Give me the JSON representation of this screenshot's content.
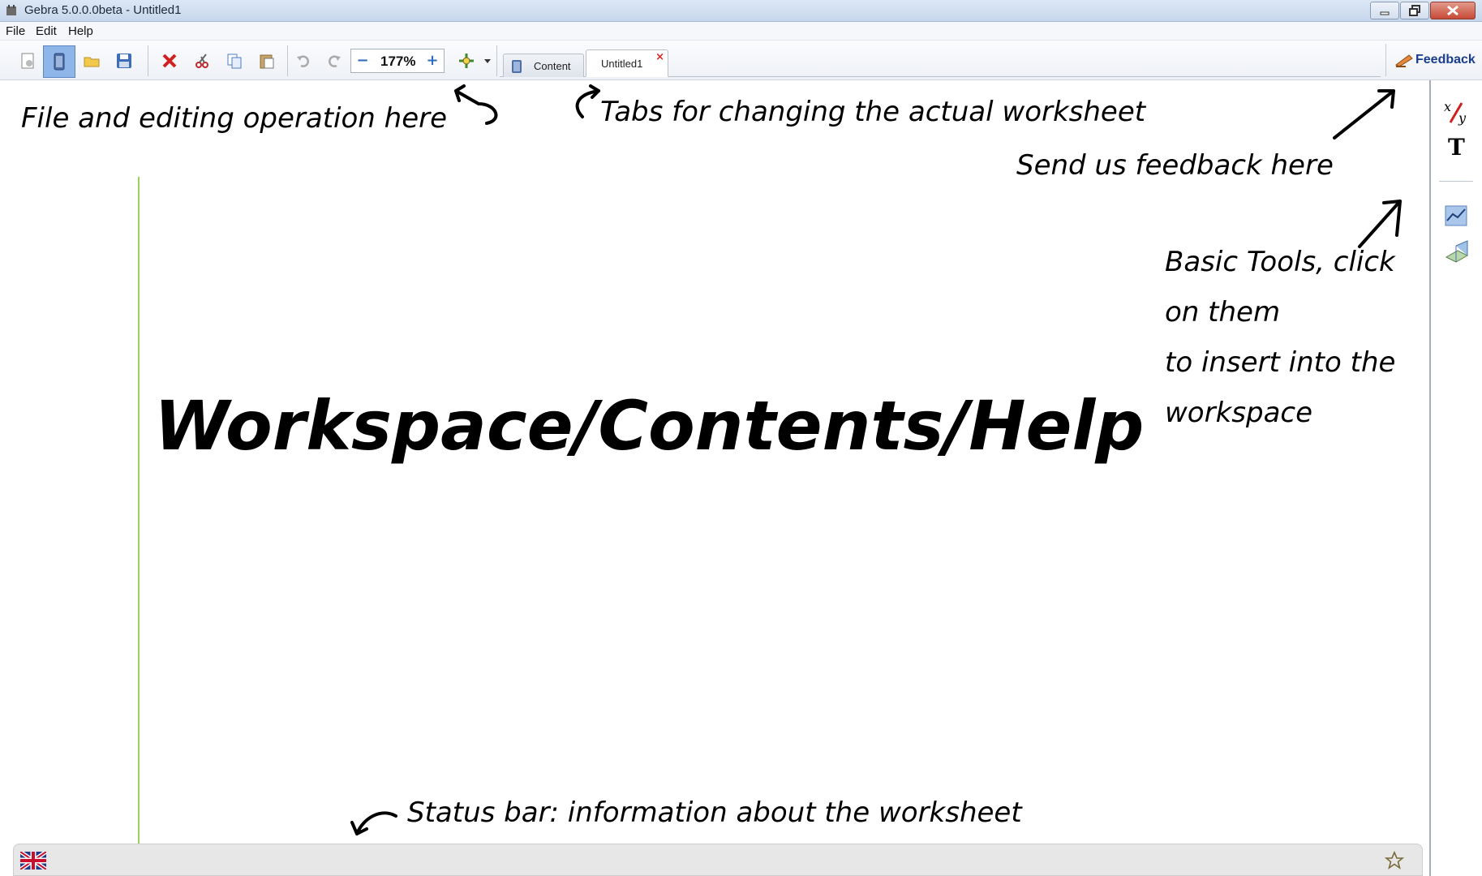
{
  "window": {
    "title": "Gebra 5.0.0.0beta - Untitled1"
  },
  "menu": {
    "items": [
      "File",
      "Edit",
      "Help"
    ]
  },
  "toolbar": {
    "zoom_value": "177%",
    "zoom_minus": "−",
    "zoom_plus": "+"
  },
  "tabs": {
    "items": [
      {
        "label": "Content",
        "active": false
      },
      {
        "label": "Untitled1",
        "active": true,
        "closable": true
      }
    ],
    "close_glyph": "×"
  },
  "feedback": {
    "label": "Feedback"
  },
  "annotations": {
    "file_ops": "File and editing operation here",
    "tabs": "Tabs  for changing the actual worksheet",
    "feedback": "Send us feedback here",
    "tools_line1": "Basic Tools, click",
    "tools_line2": "on them",
    "tools_line3": "to insert into the",
    "tools_line4": "workspace",
    "workspace": "Workspace/Contents/Help",
    "status": "Status bar: information about the worksheet"
  },
  "colors": {
    "accent": "#8fb6e8",
    "margin_line": "#9bd35a",
    "feedback_text": "#1a3c8c",
    "delete_red": "#d02020"
  },
  "icons": {
    "sidebar": [
      "fraction-icon",
      "text-icon",
      "graph-icon",
      "3d-plot-icon"
    ],
    "status": [
      "uk-flag-icon",
      "star-icon"
    ]
  }
}
